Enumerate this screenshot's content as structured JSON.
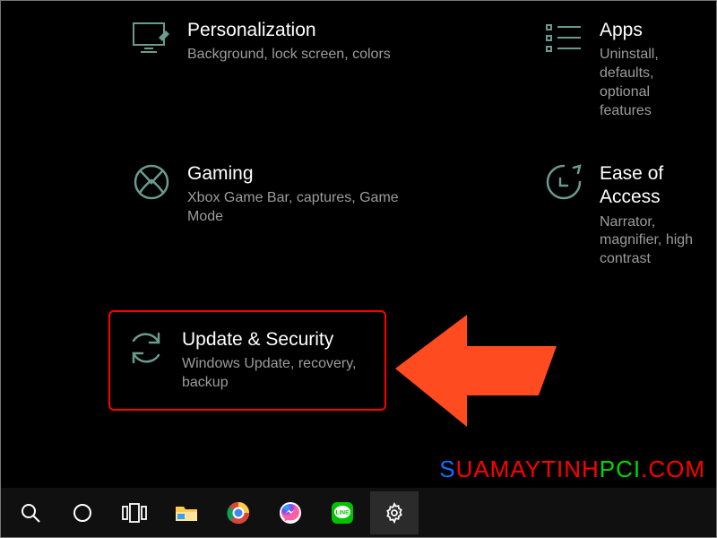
{
  "settings": {
    "personalization": {
      "title": "Personalization",
      "desc": "Background, lock screen, colors"
    },
    "apps": {
      "title": "Apps",
      "desc": "Uninstall, defaults, optional features"
    },
    "gaming": {
      "title": "Gaming",
      "desc": "Xbox Game Bar, captures, Game Mode"
    },
    "ease": {
      "title": "Ease of Access",
      "desc": "Narrator, magnifier, high contrast"
    },
    "update": {
      "title": "Update & Security",
      "desc": "Windows Update, recovery, backup"
    }
  },
  "watermark": {
    "s": "S",
    "rest": "UAMAYTINH",
    "pci": "PCI",
    "com": ".COM"
  },
  "taskbar_icons": [
    "search",
    "cortana",
    "taskview",
    "file-explorer",
    "chrome",
    "messenger",
    "line",
    "settings"
  ]
}
